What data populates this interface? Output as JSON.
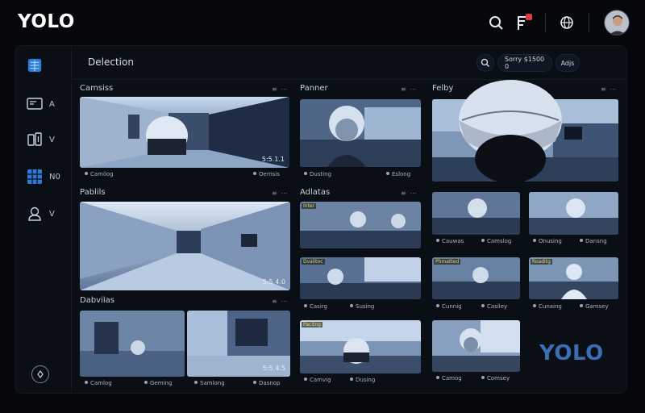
{
  "header": {
    "logo": "YOLO",
    "icons": [
      "search-icon",
      "flag-icon",
      "globe-icon"
    ],
    "notification_color": "#e23b3b"
  },
  "sidebar": {
    "items": [
      {
        "icon": "grid-logo-icon",
        "label": ""
      },
      {
        "icon": "monitor-icon",
        "label": "A"
      },
      {
        "icon": "device-icon",
        "label": "V"
      },
      {
        "icon": "camera-grid-icon",
        "label": "N0"
      },
      {
        "icon": "user-icon",
        "label": "V"
      }
    ],
    "bottom_icon": "settings-icon"
  },
  "main": {
    "title": "Delection",
    "search_icon": "search-icon",
    "pill_1": "Sorry $1500 0",
    "pill_2": "Adjs"
  },
  "panels": {
    "p1": {
      "title": "Camsiss",
      "ts": "5:5.1.1",
      "cap_left": "Camilog",
      "cap_right": "Oemsis"
    },
    "p2": {
      "title": "Panner",
      "cap_left": "Dusting",
      "cap_right": "Eslong"
    },
    "p3": {
      "title": "Felby"
    },
    "p4": {
      "title": "Pablils",
      "ts": "5:5 4.0"
    },
    "p5": {
      "title": "Adlatas"
    },
    "p6": {
      "title": "Dabvilas"
    },
    "caps": {
      "r1c3a": "Cauwas",
      "r1c3b": "Camslog",
      "r1c4a": "Onusing",
      "r1c4b": "Dansng",
      "r2c3a": "Cunnig",
      "r2c3b": "Casiley",
      "r2c4a": "Cunaing",
      "r2c4b": "Gamsey",
      "r3c3a": "Camog",
      "r3c3b": "Comsey",
      "r1c2a": "Dusting",
      "r1c2b": "Eslong",
      "r2c2a": "Casirg",
      "r2c2b": "Susing",
      "r3c2a": "Camvig",
      "r3c2b": "Dusing",
      "p6a": "Camlog",
      "p6b": "Geming",
      "p6c": "Samlong",
      "p6d": "Dasnop"
    },
    "feed_tags": {
      "t1": "Inter",
      "t2": "Dvalitoc",
      "t3": "Phmatted",
      "t4": "Roaditg",
      "t5": "Pacitng"
    },
    "p6_ts": "5:5.4.5"
  },
  "brand_mark": "YOLO",
  "colors": {
    "accent": "#3b6fb3",
    "background": "#05070b"
  }
}
